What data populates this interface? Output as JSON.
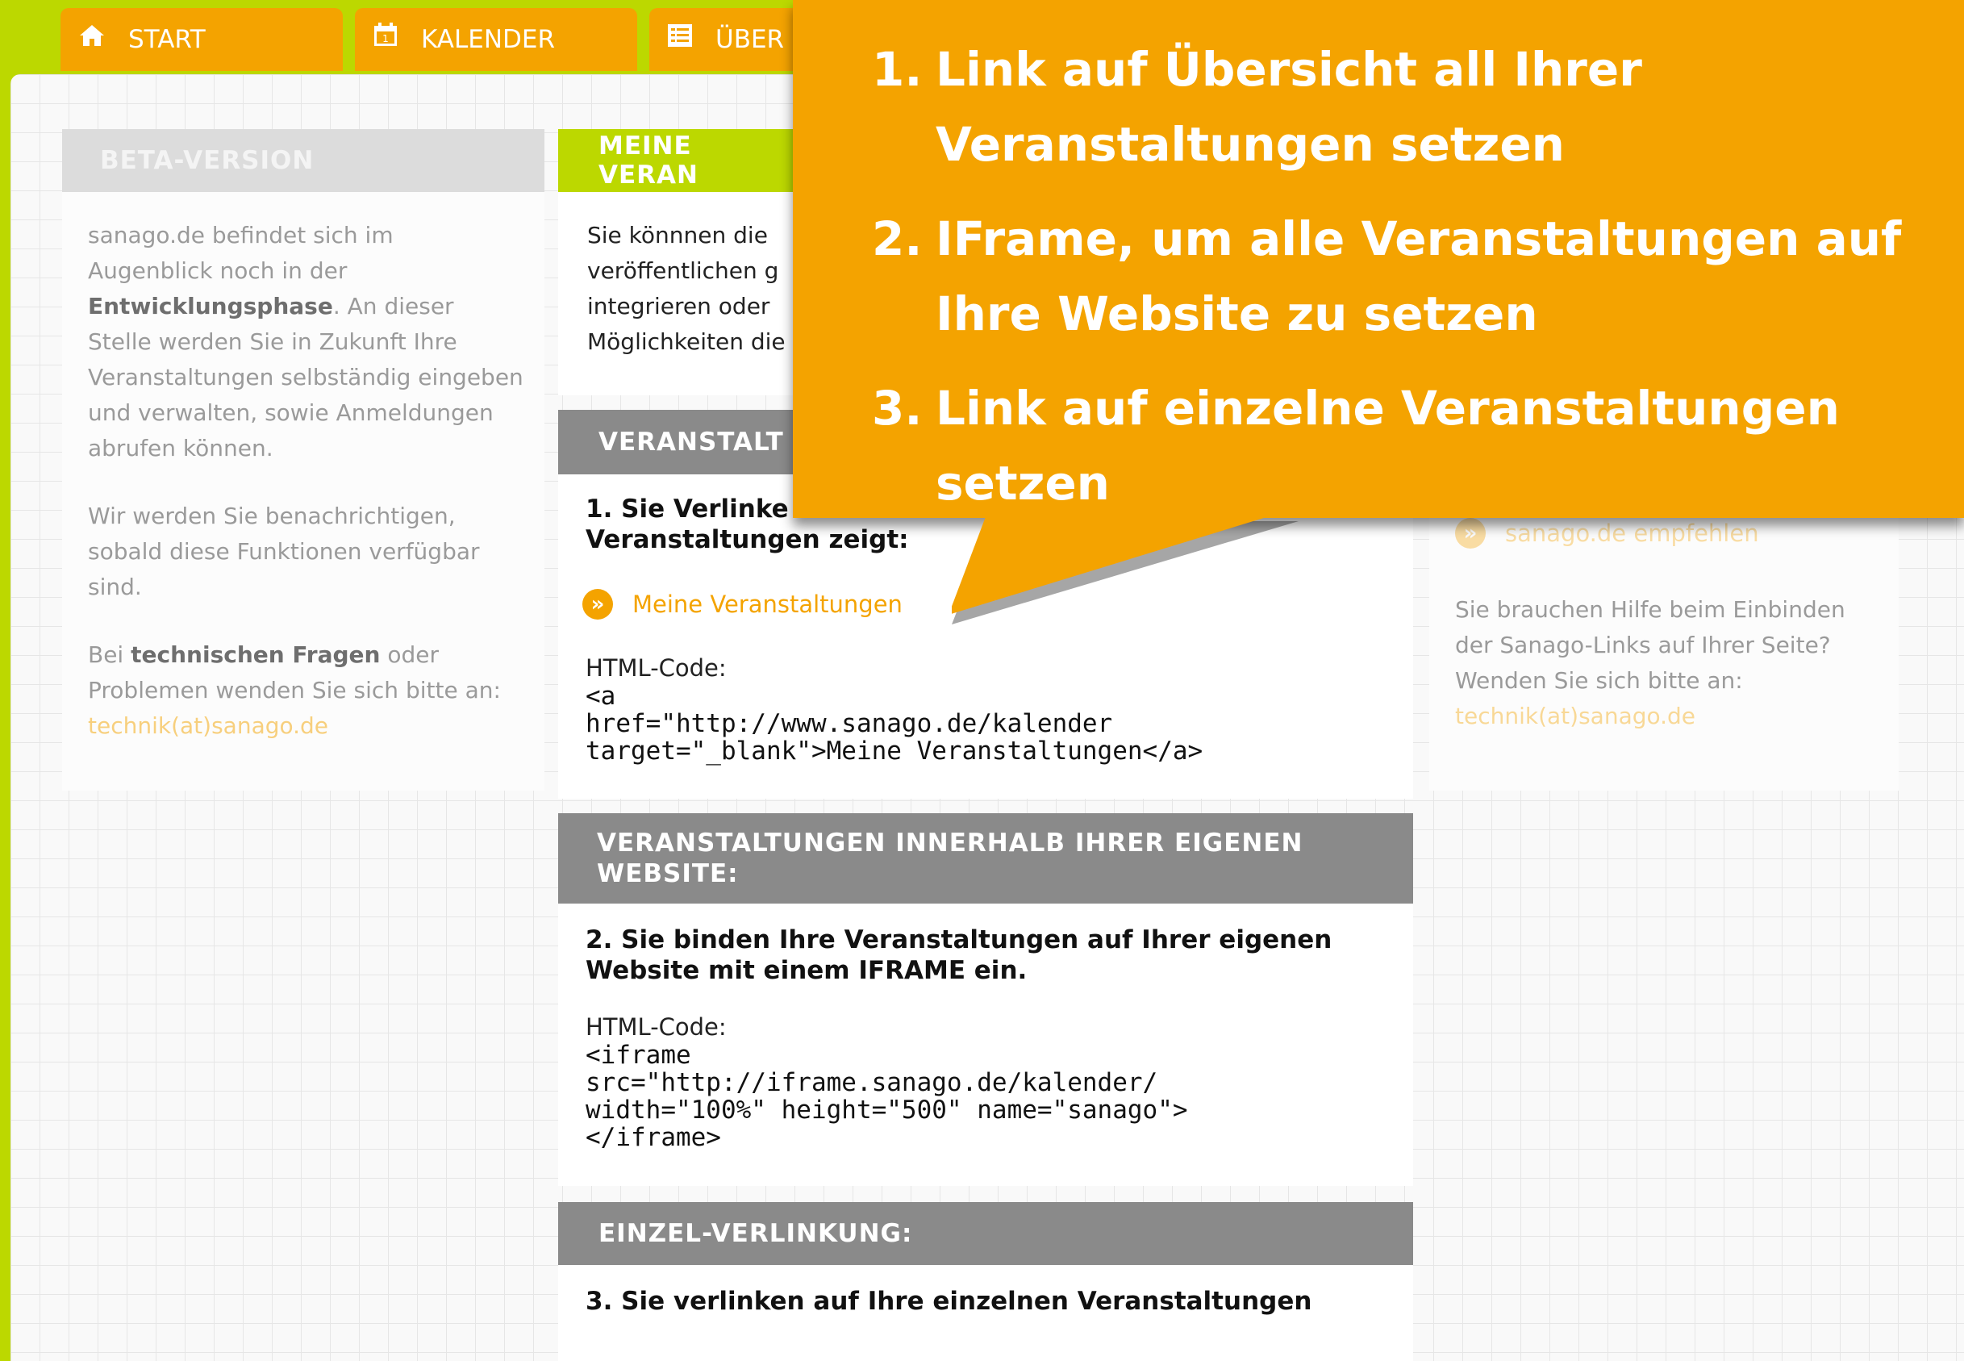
{
  "nav": {
    "tabs": [
      {
        "label": "START",
        "icon": "home-icon"
      },
      {
        "label": "KALENDER",
        "icon": "calendar-icon"
      },
      {
        "label": "ÜBER",
        "icon": "list-icon"
      }
    ]
  },
  "beta": {
    "title": "BETA-VERSION",
    "p1_a": "sanago.de befindet sich im Augenblick noch in der ",
    "p1_bold": "Entwicklungsphase",
    "p1_b": ". An dieser Stelle werden Sie in Zukunft Ihre Veranstaltungen selbständig eingeben und verwalten, sowie Anmeldungen abrufen können.",
    "p2": "Wir werden Sie benachrichtigen, sobald diese Funktionen verfügbar sind.",
    "p3_a": "Bei ",
    "p3_bold": "technischen Fragen",
    "p3_b": " oder Problemen wenden Sie sich bitte an: ",
    "p3_link": "technik(at)sanago.de"
  },
  "meine": {
    "title": "MEINE VERAN",
    "text": "Sie könnnen die veröffentlichen g integrieren oder Möglichkeiten die"
  },
  "veranstalt": {
    "title": "VERANSTALT",
    "step1": "1. Sie Verlinke Veranstaltungen zeigt:",
    "link_label": "Meine Veranstaltungen",
    "code_label": "HTML-Code:",
    "code": "<a\nhref=\"http://www.sanago.de/kalender\ntarget=\"_blank\">Meine Veranstaltungen</a>"
  },
  "innerhalb": {
    "title": "VERANSTALTUNGEN INNERHALB IHRER EIGENEN WEBSITE:",
    "step2": "2. Sie binden Ihre Veranstaltungen auf Ihrer eigenen Website mit einem IFRAME ein.",
    "code_label": "HTML-Code:",
    "code": "<iframe\nsrc=\"http://iframe.sanago.de/kalender/\nwidth=\"100%\" height=\"500\" name=\"sanago\">\n</iframe>"
  },
  "einzel": {
    "title": "EINZEL-VERLINKUNG:",
    "step3": "3. Sie verlinken auf Ihre einzelnen Veranstaltungen"
  },
  "right": {
    "recommend": "sanago.de empfehlen",
    "help_a": "Sie brauchen Hilfe beim Einbinden der Sanago-Links auf Ihrer Seite? Wenden Sie sich bitte an: ",
    "help_link": "technik(at)sanago.de"
  },
  "callout": {
    "items": [
      {
        "num": "1.",
        "text": "Link auf Übersicht all Ihrer Veranstaltungen setzen"
      },
      {
        "num": "2.",
        "text": "IFrame, um alle Veranstaltungen auf Ihre Website zu setzen"
      },
      {
        "num": "3.",
        "text": "Link auf einzelne Veranstaltungen setzen"
      }
    ]
  },
  "colors": {
    "accent": "#f4a300",
    "lime": "#bcd800",
    "header_gray": "#8a8a8a"
  }
}
